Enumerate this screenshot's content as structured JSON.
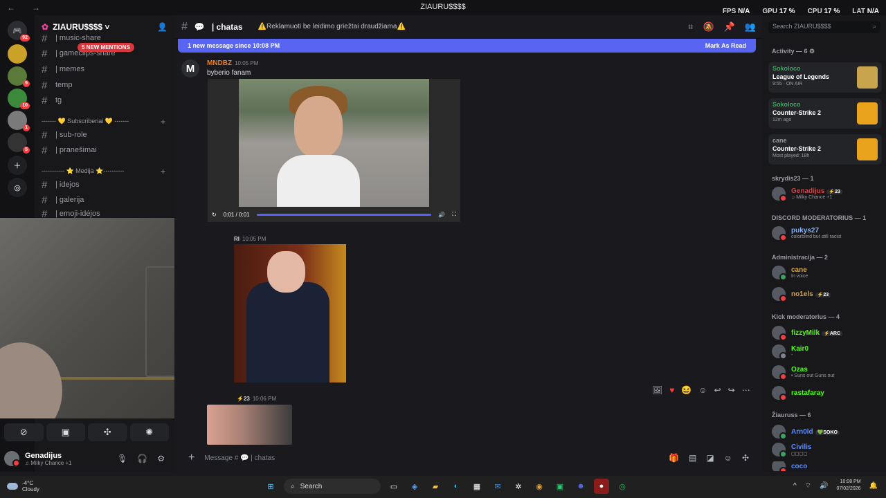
{
  "titlebar": {
    "title": "ZIAURU$$$$",
    "back": "←",
    "fwd": "→"
  },
  "hud": {
    "fps_label": "FPS",
    "fps": "N/A",
    "gpu_label": "GPU",
    "gpu": "17 %",
    "cpu_label": "CPU",
    "cpu": "17 %",
    "lat_label": "LAT",
    "lat": "N/A"
  },
  "rail": {
    "badges": [
      "92",
      "9",
      "10",
      "1",
      "5"
    ]
  },
  "server": {
    "name": "ZIAURU$$$$ ˅"
  },
  "channels": {
    "music_share": "| music-share",
    "gameclips_share": "| gameclips-share",
    "memes": "| memes",
    "temp": "temp",
    "tg": "tg",
    "cat_subs": "------- 💛 Subscriberiai 💛 -------",
    "sub_role": "| sub-role",
    "pranesimai": "| pranešimai",
    "cat_media": "----------- ⭐ Medija ⭐----------",
    "idejos": "| idejos",
    "galerija": "| galerija",
    "emoji_idejos": "| emoji-idėjos",
    "mentions": "5 NEW MENTIONS"
  },
  "user": {
    "name": "Genadijus",
    "status": "♫ Milky Chance +1"
  },
  "chat": {
    "channel": "| chatas",
    "topic": "⚠️Reklamuoti be leidimo griežtai draudžiama⚠️",
    "new_msg": "1 new message since 10:08 PM",
    "mark_read": "Mark As Read",
    "msg1_author": "MNDBZ",
    "msg1_time": "10:05 PM",
    "msg1_text": "byberio fanam",
    "video_time": "0:01 / 0:01",
    "msg2_author": "RI",
    "msg2_time": "10:05 PM",
    "msg3_author": "⚡23",
    "msg3_time": "10:06 PM",
    "placeholder": "Message # 💬 | chatas"
  },
  "members": {
    "search": "Search ZIAURU$$$$",
    "activity": "Activity — 6 ⚙",
    "act": [
      {
        "user": "Sokoloco",
        "game": "League of Legends",
        "detail": "9:55 · ON AIR"
      },
      {
        "user": "Sokoloco",
        "game": "Counter-Strike 2",
        "detail": "12m ago"
      },
      {
        "user": "cane",
        "game": "Counter-Strike 2",
        "detail": "Most played: 18h"
      }
    ],
    "sec_skrydis": "skrydis23 — 1",
    "genadijus": "Genadijus",
    "genadijus_sub": "♫ Milky Chance +1",
    "sec_dmod": "DISCORD MODERATORIUS — 1",
    "pukys": "pukys27",
    "pukys_sub": "colorblind but still racist",
    "sec_admin": "Administracija — 2",
    "cane": "cane",
    "cane_sub": "In voice",
    "no1els": "no1els",
    "sec_kick": "Kick moderatorius — 4",
    "fizzy": "fizzyMilk",
    "kair": "Kair0",
    "kair_sub": "-",
    "ozas": "Ozas",
    "ozas_sub": "• Suns out Guns out",
    "rasta": "rastafaray",
    "sec_ziauruss": "Žiauruss — 6",
    "arnold": "Arn0ld",
    "civilis": "Civilis",
    "civilis_sub": "◻◻◻◻",
    "coco": "coco",
    "tag23": "⚡23",
    "tagarc": "⚡ARC",
    "tagsoko": "💚SOKO"
  },
  "taskbar": {
    "temp": "-4°C",
    "weather": "Cloudy",
    "search": "Search",
    "time": "10:08 PM",
    "date": "07/02/2026"
  },
  "colors": {
    "accent": "#5865f2",
    "bg": "#1a1a1e",
    "mention": "#da373c"
  }
}
